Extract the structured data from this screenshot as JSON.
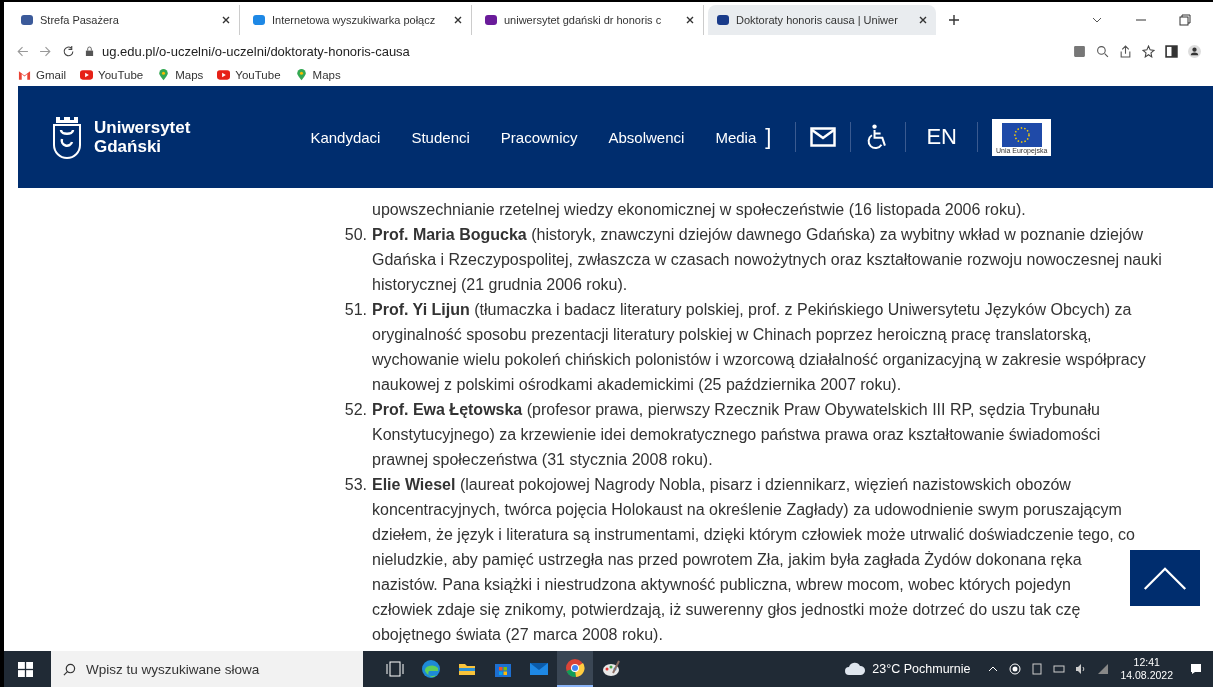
{
  "browser": {
    "tabs": [
      {
        "title": "Strefa Pasażera",
        "selected": false
      },
      {
        "title": "Internetowa wyszukiwarka połącz",
        "selected": false
      },
      {
        "title": "uniwersytet gdański dr honoris c",
        "selected": false
      },
      {
        "title": "Doktoraty honoris causa | Uniwer",
        "selected": true
      }
    ],
    "address": "ug.edu.pl/o-uczelni/o-uczelni/doktoraty-honoris-causa",
    "bookmarks": [
      {
        "label": "Gmail",
        "kind": "gmail"
      },
      {
        "label": "YouTube",
        "kind": "youtube"
      },
      {
        "label": "Maps",
        "kind": "maps"
      },
      {
        "label": "YouTube",
        "kind": "youtube"
      },
      {
        "label": "Maps",
        "kind": "maps"
      }
    ]
  },
  "header": {
    "logo_lines": [
      "Uniwersytet",
      "Gdański"
    ],
    "nav": [
      "Kandydaci",
      "Studenci",
      "Pracownicy",
      "Absolwenci",
      "Media"
    ],
    "bracket": "]",
    "language": "EN",
    "eu_label": "Unia Europejska"
  },
  "entries": [
    {
      "lines": [
        "upowszechnianie rzetelnej wiedzy ekonomicznej w społeczeństwie (16 listopada 2006 roku)."
      ]
    },
    {
      "number": "50.",
      "lines": [
        "**Prof. Maria Bogucka** (historyk, znawczyni dziejów dawnego Gdańska) za wybitny wkład w poznanie dziejów",
        "Gdańska i Rzeczypospolitej, zwłaszcza w czasach nowożytnych oraz kształtowanie rozwoju nowoczesnej nauki",
        "historycznej (21 grudnia 2006 roku)."
      ]
    },
    {
      "number": "51.",
      "lines": [
        "**Prof. Yi Lijun** (tłumaczka i badacz literatury polskiej, prof. z Pekińskiego Uniwersytetu Języków Obcych) za",
        "oryginalność sposobu prezentacji literatury polskiej w Chinach poprzez heroiczną pracę translatorską,",
        "wychowanie wielu pokoleń chińskich polonistów i wzorcową działalność organizacyjną w zakresie współpracy",
        "naukowej z polskimi ośrodkami akademickimi (25 października 2007 roku)."
      ]
    },
    {
      "number": "52.",
      "lines": [
        "**Prof. Ewa Łętowska** (profesor prawa, pierwszy Rzecznik Praw Obywatelskich III RP, sędzia Trybunału",
        "Konstytucyjnego) za krzewienie idei demokratycznego państwa prawa oraz kształtowanie świadomości",
        "prawnej społeczeństwa (31 stycznia 2008 roku)."
      ]
    },
    {
      "number": "53.",
      "lines": [
        "**Elie Wiesel** (laureat pokojowej Nagrody Nobla, pisarz i dziennikarz, więzień nazistowskich obozów",
        "koncentracyjnych, twórca pojęcia Holokaust na określenie Zagłady) za udowodnienie swym poruszającym",
        "dziełem, że język i literatura są instrumentami, dzięki którym człowiek może utrwalić doświadczenie tego, co",
        "nieludzkie, aby pamięć ustrzegła nas przed powrotem Zła, jakim była zagłada Żydów dokonana ręka",
        "nazistów. Pana książki i niestrudzona aktywność publiczna, wbrew mocom, wobec których pojedyn",
        "człowiek zdaje się znikomy, potwierdzają, iż suwerenny głos jednostki może dotrzeć do uszu tak czę",
        "obojętnego świata (27 marca 2008 roku)."
      ]
    }
  ],
  "taskbar": {
    "search_placeholder": "Wpisz tu wyszukiwane słowa",
    "weather": "23°C Pochmurnie",
    "time": "12:41",
    "date": "14.08.2022"
  }
}
